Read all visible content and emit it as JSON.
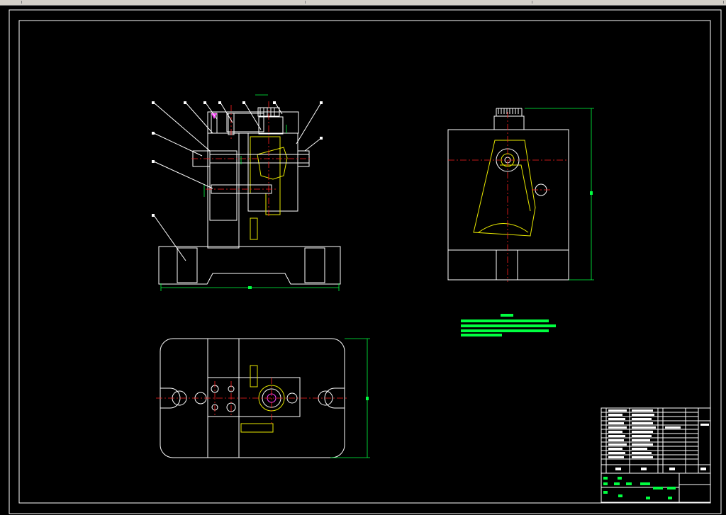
{
  "window": {
    "toolbar": {
      "segments": 4
    }
  },
  "drawing": {
    "background_color": "#000000",
    "line_color": "#ffffff",
    "center_line_color": "#ff2020",
    "dimension_color": "#00ff40",
    "part_color": "#e8e800",
    "views": [
      "front-section-view",
      "side-view",
      "top-view"
    ],
    "leaders_count": 11,
    "title_block_rows": 13
  }
}
